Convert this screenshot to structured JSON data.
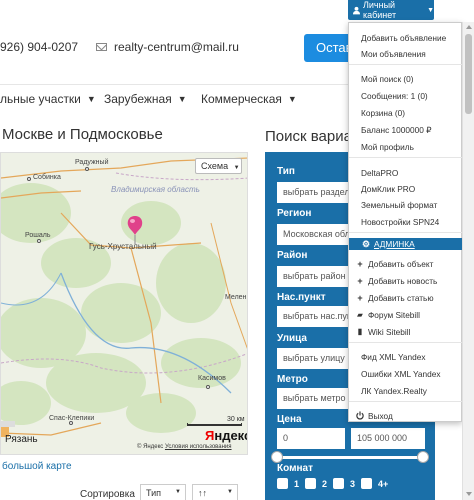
{
  "topbar": {
    "cabinet_label": "Личный кабинет"
  },
  "contacts": {
    "phone": "926) 904-0207",
    "email": "realty-centrum@mail.ru",
    "post_button": "Остав"
  },
  "nav": {
    "items": [
      {
        "label": "льные участки"
      },
      {
        "label": "Зарубежная"
      },
      {
        "label": "Коммерческая"
      }
    ]
  },
  "map_section": {
    "heading": "Москве и Подмосковье",
    "scheme_button": "Схема",
    "region_label": "Владимирская область",
    "cities": [
      "Собинка",
      "Радужный",
      "Рошаль",
      "Гусь-Хрустальный",
      "Спас-Клепики",
      "Касимов",
      "Рязань",
      "Мелен"
    ],
    "scale": "30 км",
    "logo": "Яндекс",
    "copyright": "© Яндекс",
    "terms_link": "Условия использования",
    "big_map_link": "большой карте"
  },
  "sort": {
    "label": "Сортировка",
    "type_value": "Тип",
    "order_value": "↑↑"
  },
  "search": {
    "heading": "Поиск вариа",
    "fields": [
      {
        "label": "Тип",
        "value": "выбрать раздел"
      },
      {
        "label": "Регион",
        "value": "Московская обла"
      },
      {
        "label": "Район",
        "value": "выбрать район"
      },
      {
        "label": "Нас.пункт",
        "value": "выбрать нас.пун"
      },
      {
        "label": "Улица",
        "value": "выбрать улицу"
      },
      {
        "label": "Метро",
        "value": "выбрать метро"
      }
    ],
    "price_label": "Цена",
    "price_from": "0",
    "price_to": "105 000 000",
    "rooms_label": "Комнат",
    "rooms": [
      "1",
      "2",
      "3",
      "4+"
    ]
  },
  "dropdown": {
    "items": [
      {
        "label": "Добавить объявление",
        "icon": ""
      },
      {
        "label": "Мои объявления",
        "icon": ""
      },
      {
        "label": "Мой поиск (0)",
        "icon": ""
      },
      {
        "label": "Сообщения: 1 (0)",
        "icon": ""
      },
      {
        "label": "Корзина (0)",
        "icon": ""
      },
      {
        "label": "Баланс 1000000 ₽",
        "icon": ""
      },
      {
        "label": "Мой профиль",
        "icon": ""
      },
      {
        "label": "DeltaPRO",
        "icon": ""
      },
      {
        "label": "ДомКлик PRO",
        "icon": ""
      },
      {
        "label": "Земельный формат",
        "icon": ""
      },
      {
        "label": "Новостройки SPN24",
        "icon": ""
      },
      {
        "label": "АДМИНКА",
        "icon": "gear-icon"
      },
      {
        "label": "Добавить объект",
        "icon": "plus-icon"
      },
      {
        "label": "Добавить новость",
        "icon": "plus-icon"
      },
      {
        "label": "Добавить статью",
        "icon": "plus-icon"
      },
      {
        "label": "Форум Sitebill",
        "icon": "comments-icon"
      },
      {
        "label": "Wiki Sitebill",
        "icon": "book-icon"
      },
      {
        "label": "Фид XML Yandex",
        "icon": ""
      },
      {
        "label": "Ошибки XML Yandex",
        "icon": ""
      },
      {
        "label": "ЛК Yandex.Realty",
        "icon": ""
      },
      {
        "label": "Выход",
        "icon": "power-icon"
      }
    ]
  },
  "colors": {
    "primary": "#1a6fa8",
    "button_blue": "#1c8ce0",
    "pin": "#e0418a"
  }
}
